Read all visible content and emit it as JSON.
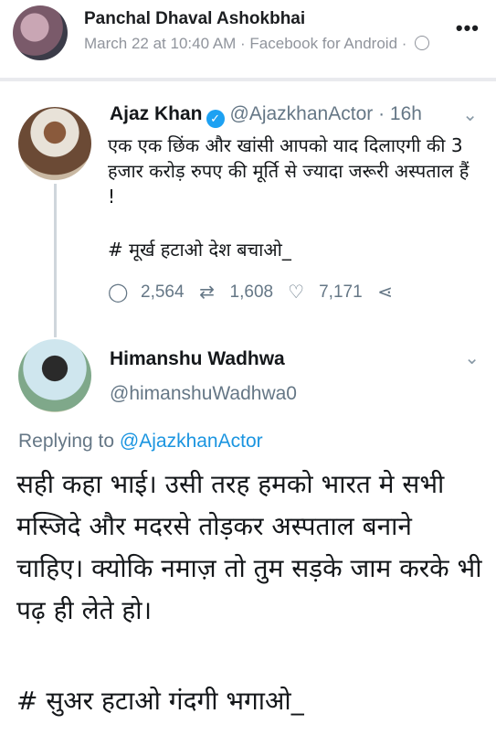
{
  "post": {
    "author": "Panchal Dhaval Ashokbhai",
    "meta": "March 22 at 10:40 AM · Facebook for Android ·",
    "more": "•••"
  },
  "tweet1": {
    "name": "Ajaz Khan",
    "handle_time": "@AjazkhanActor · 16h",
    "text": "एक एक छिंक और खांसी आपको याद दिलाएगी की 3 हजार करोड़ रुपए की मूर्ति से ज्यादा जरूरी अस्पताल हैं !",
    "hashtag": "# मूर्ख हटाओ देश बचाओ_",
    "replies": "2,564",
    "retweets": "1,608",
    "likes": "7,171"
  },
  "tweet2": {
    "name": "Himanshu Wadhwa",
    "handle": "@himanshuWadhwa0",
    "replying_prefix": "Replying to",
    "replying_to": "@AjazkhanActor",
    "text": "सही कहा भाई। उसी तरह हमको भारत मे सभी मस्जिदे और मदरसे तोड़कर अस्पताल बनाने चाहिए। क्योकि नमाज़ तो तुम सड़के जाम करके भी पढ़ ही लेते हो।",
    "hashtag": "# सुअर हटाओ गंदगी भगाओ_"
  },
  "icons": {
    "verified": "✓",
    "chevron": "⌄",
    "reply": "◯",
    "retweet": "⇄",
    "like": "♡",
    "share": "⋖"
  }
}
